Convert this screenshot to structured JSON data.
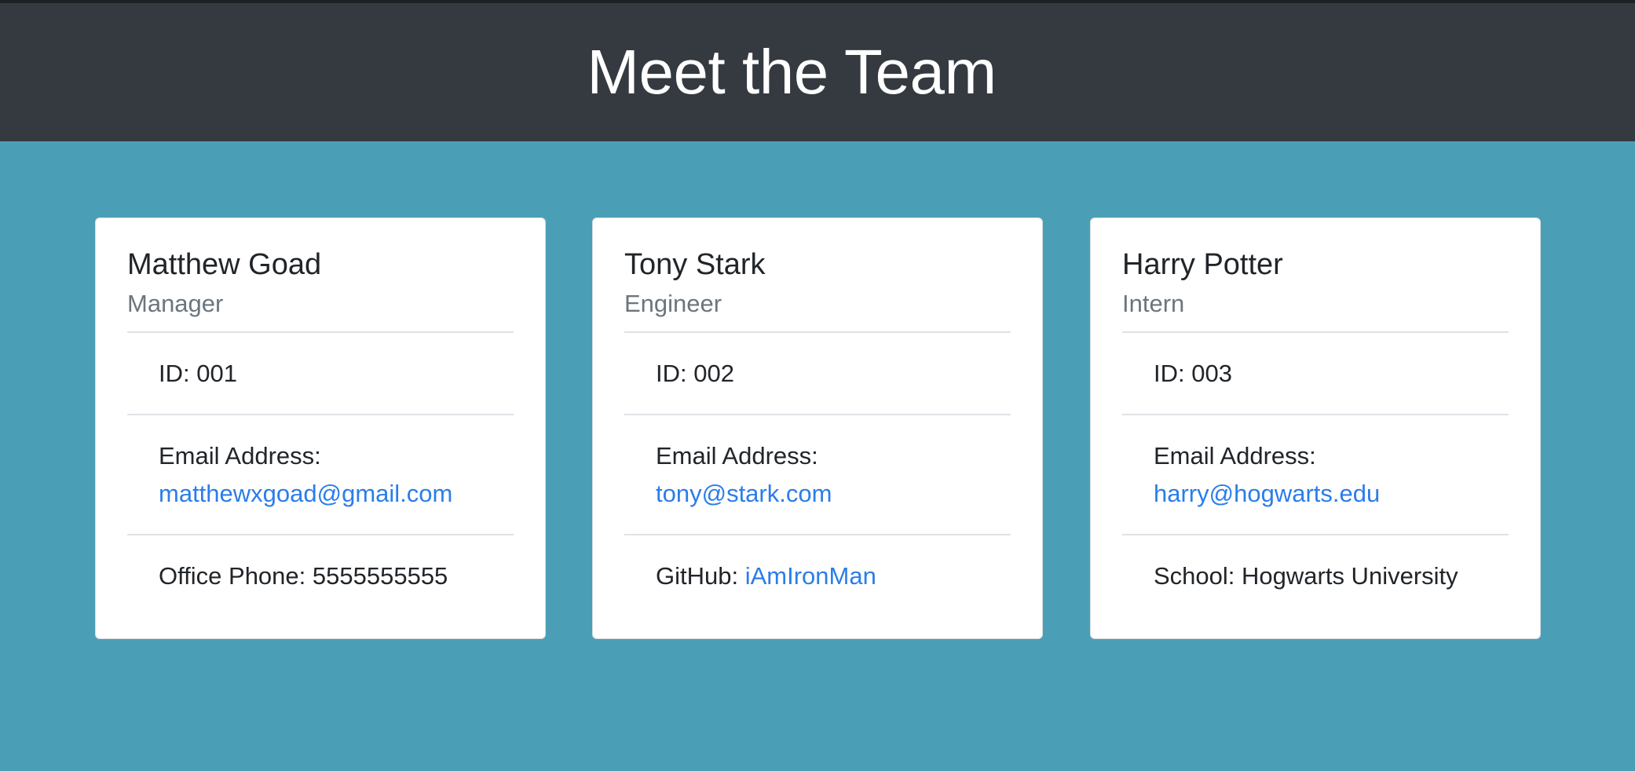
{
  "page": {
    "title": "Meet the Team",
    "colors": {
      "background": "#4a9fb7",
      "header": "#343a40",
      "link": "#2b7de9",
      "subtitle": "#6c757d"
    }
  },
  "team": [
    {
      "name": "Matthew Goad",
      "role": "Manager",
      "id_text": "ID: 001",
      "email_label": "Email Address:",
      "email": "matthewxgoad@gmail.com",
      "extra_label": "Office Phone: ",
      "extra_value": "5555555555",
      "extra_is_link": false
    },
    {
      "name": "Tony Stark",
      "role": "Engineer",
      "id_text": "ID: 002",
      "email_label": "Email Address:",
      "email": "tony@stark.com",
      "extra_label": "GitHub: ",
      "extra_value": "iAmIronMan",
      "extra_is_link": true
    },
    {
      "name": "Harry Potter",
      "role": "Intern",
      "id_text": "ID: 003",
      "email_label": "Email Address:",
      "email": "harry@hogwarts.edu",
      "extra_label": "School: ",
      "extra_value": "Hogwarts University",
      "extra_is_link": false
    }
  ]
}
